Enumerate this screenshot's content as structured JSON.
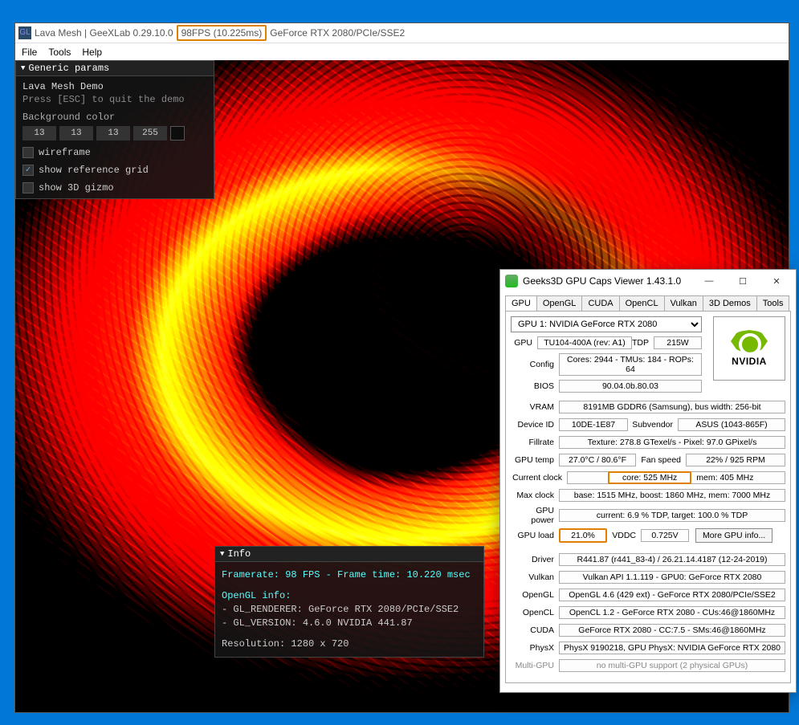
{
  "window": {
    "title_app": "Lava Mesh | GeeXLab 0.29.10.0",
    "title_fps": "98FPS (10.225ms)",
    "title_gpu": "GeForce RTX 2080/PCIe/SSE2",
    "menu": {
      "file": "File",
      "tools": "Tools",
      "help": "Help"
    }
  },
  "params": {
    "header": "Generic params",
    "demo_title": "Lava Mesh Demo",
    "hint": "Press [ESC] to quit the demo",
    "bgcolor_label": "Background color",
    "bg": [
      "13",
      "13",
      "13",
      "255"
    ],
    "cb_wireframe": "wireframe",
    "cb_grid": "show reference grid",
    "cb_gizmo": "show 3D gizmo",
    "grid_checked": true
  },
  "info": {
    "header": "Info",
    "framerate": "Framerate: 98 FPS - Frame time: 10.220 msec",
    "ogl_title": "OpenGL info:",
    "renderer": "- GL_RENDERER: GeForce RTX 2080/PCIe/SSE2",
    "version": "- GL_VERSION: 4.6.0 NVIDIA 441.87",
    "res": "Resolution: 1280 x 720"
  },
  "caps": {
    "title": "Geeks3D GPU Caps Viewer 1.43.1.0",
    "tabs": [
      "GPU",
      "OpenGL",
      "CUDA",
      "OpenCL",
      "Vulkan",
      "3D Demos",
      "Tools"
    ],
    "gpu_select": "GPU 1: NVIDIA GeForce RTX 2080",
    "logo_text": "NVIDIA",
    "rows": {
      "gpu_l": "GPU",
      "gpu_v": "TU104-400A (rev: A1)",
      "tdp_l": "TDP",
      "tdp_v": "215W",
      "config_l": "Config",
      "config_v": "Cores: 2944 - TMUs: 184 - ROPs: 64",
      "bios_l": "BIOS",
      "bios_v": "90.04.0b.80.03",
      "vram_l": "VRAM",
      "vram_v": "8191MB GDDR6 (Samsung), bus width: 256-bit",
      "devid_l": "Device ID",
      "devid_v": "10DE-1E87",
      "subv_l": "Subvendor",
      "subv_v": "ASUS (1043-865F)",
      "fill_l": "Fillrate",
      "fill_v": "Texture: 278.8 GTexel/s - Pixel: 97.0 GPixel/s",
      "temp_l": "GPU temp",
      "temp_v": "27.0°C / 80.6°F",
      "fan_l": "Fan speed",
      "fan_v": "22% / 925 RPM",
      "cclk_l": "Current clock",
      "cclk_v": "core: 525 MHz",
      "cclk_mem": "mem: 405 MHz",
      "mclk_l": "Max clock",
      "mclk_v": "base: 1515 MHz, boost: 1860 MHz, mem: 7000 MHz",
      "pow_l": "GPU power",
      "pow_v": "current: 6.9 % TDP, target: 100.0 % TDP",
      "load_l": "GPU load",
      "load_v": "21.0%",
      "vddc_l": "VDDC",
      "vddc_v": "0.725V",
      "more": "More GPU info...",
      "drv_l": "Driver",
      "drv_v": "R441.87 (r441_83-4) / 26.21.14.4187 (12-24-2019)",
      "vk_l": "Vulkan",
      "vk_v": "Vulkan API 1.1.119 - GPU0: GeForce RTX 2080",
      "ogl_l": "OpenGL",
      "ogl_v": "OpenGL 4.6 (429 ext) - GeForce RTX 2080/PCIe/SSE2",
      "ocl_l": "OpenCL",
      "ocl_v": "OpenCL 1.2 - GeForce RTX 2080 - CUs:46@1860MHz",
      "cuda_l": "CUDA",
      "cuda_v": "GeForce RTX 2080 - CC:7.5 - SMs:46@1860MHz",
      "physx_l": "PhysX",
      "physx_v": "PhysX 9190218, GPU PhysX: NVIDIA GeForce RTX 2080",
      "mgpu_l": "Multi-GPU",
      "mgpu_v": "no multi-GPU support (2 physical GPUs)"
    }
  }
}
